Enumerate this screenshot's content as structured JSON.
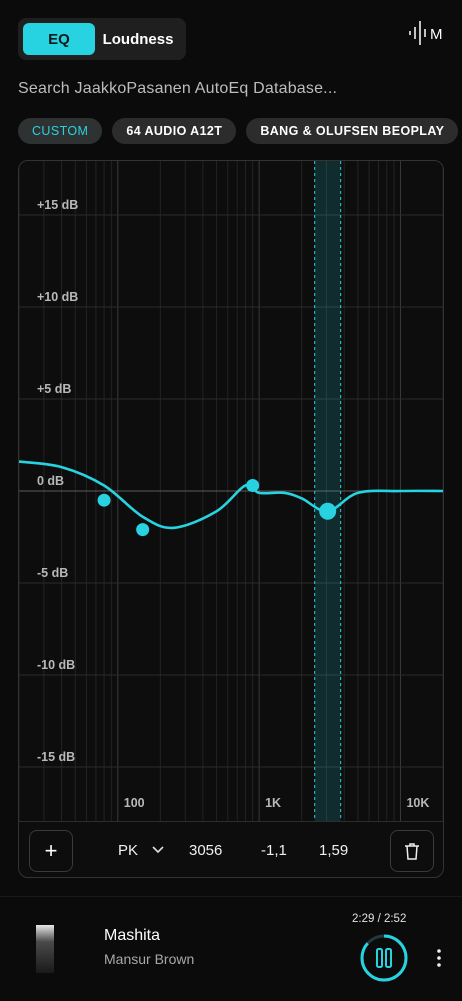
{
  "tabs": {
    "eq": "EQ",
    "loudness": "Loudness"
  },
  "brand_letter": "M",
  "search": {
    "placeholder": "Search JaakkoPasanen AutoEq Database..."
  },
  "chips": [
    "CUSTOM",
    "64 AUDIO A12T",
    "BANG & OLUFSEN BEOPLAY"
  ],
  "chart_data": {
    "type": "line",
    "title": "",
    "x_scale": "log",
    "x_ticks": [
      "100",
      "1K",
      "10K"
    ],
    "y_ticks": [
      "+15 dB",
      "+10 dB",
      "+5 dB",
      "0 dB",
      "-5 dB",
      "-10 dB",
      "-15 dB"
    ],
    "ylim": [
      -18,
      18
    ],
    "grid": true,
    "series": [
      {
        "values_hz": [
          20,
          40,
          80,
          150,
          250,
          500,
          800,
          1000,
          1500,
          2000,
          3056,
          5000,
          10000,
          20000
        ],
        "values_db": [
          1.6,
          1.3,
          0.3,
          -1.4,
          -2.0,
          -1.1,
          0.3,
          -0.1,
          -0.1,
          -0.4,
          -1.1,
          -0.1,
          0,
          0
        ]
      }
    ],
    "bands": [
      {
        "freq": 80,
        "gain": -0.5
      },
      {
        "freq": 150,
        "gain": -2.1
      },
      {
        "freq": 900,
        "gain": 0.3
      },
      {
        "freq": 3056,
        "gain": -1.1
      }
    ],
    "selected_band": {
      "freq": 3056,
      "gain": -1.1,
      "q": 1.59
    },
    "accent": "#27d3e0"
  },
  "band_editor": {
    "add": "+",
    "type": "PK",
    "freq": "3056",
    "gain": "-1,1",
    "q": "1,59"
  },
  "player": {
    "song": "Mashita",
    "artist": "Mansur Brown",
    "time": "2:29 / 2:52",
    "progress": 0.866
  }
}
